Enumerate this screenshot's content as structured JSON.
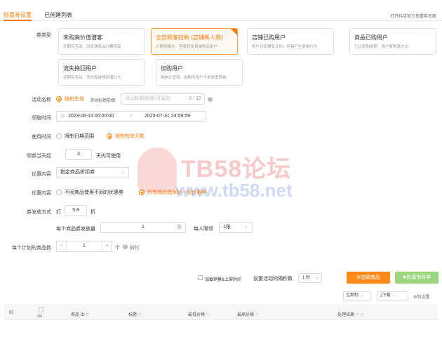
{
  "tabs": [
    {
      "label": "惊喜券设置"
    },
    {
      "label": "已创建列表"
    }
  ],
  "top_right_link": "打开抖店官方惊喜券页面",
  "coupon_type": {
    "label": "券类型",
    "cards": [
      {
        "title": "未购高价值潜客",
        "desc": "近期有互动、对店铺商品兴趣很高"
      },
      {
        "title": "全部新客拉新 (店铺新人券)",
        "desc": "人群规模大、容易转化首单购买用户"
      },
      {
        "title": "店铺已购用户",
        "desc": "用户对店铺有认知、容易产生复购行为"
      },
      {
        "title": "商品已购用户",
        "desc": "已过复购周期、用户复购潜力大"
      },
      {
        "title": "流失挽回用户",
        "desc": "近期有互动、流失者被挽回潜力大"
      },
      {
        "title": "加购用户",
        "desc": "购物车营销、加购的用户下单意愿很强"
      }
    ]
  },
  "activity_name": {
    "label": "活动名称",
    "option": "随机生成",
    "prefix_label": "活动标题前缀:",
    "placeholder": "活动标题前缀,可留空",
    "counter": "0 / 10"
  },
  "claim_time": {
    "label": "领取时间",
    "start": "2023-06-13 00:00:00",
    "sep": "-",
    "end": "2023-07-31 23:59:59"
  },
  "use_time": {
    "label": "使用时间",
    "options": [
      "限制日期范围",
      "限制有效天数"
    ]
  },
  "valid_days": {
    "label": "领券当天起",
    "value": "3",
    "suffix": "天内可使用"
  },
  "discount_content": {
    "label": "优惠内容",
    "value": "指定商品折扣券"
  },
  "discount_content2": {
    "label": "优惠内容",
    "options": [
      "不同商品使用不同的优惠券",
      "所有商品使用同一张优惠券"
    ]
  },
  "issue_method": {
    "label": "券发放方式",
    "prefix": "打",
    "value": "5.8",
    "suffix": "折"
  },
  "per_item": {
    "label": "每个商品券发放量",
    "value": "1",
    "unit": "张"
  },
  "per_person": {
    "label": "每人限领",
    "value": "1张"
  },
  "per_plan": {
    "label": "每个计划的商品数",
    "minus": "−",
    "value": "1",
    "plus": "+",
    "unit": "个",
    "help": "解析"
  },
  "toolbar": {
    "checkbox_label": "加载销量&上架时间",
    "interval_label": "设置活动间隔秒数",
    "interval_value": "1 秒",
    "load_btn": "⊕加载商品",
    "batch_btn": "批量惊喜券"
  },
  "table_tools": {
    "copy": "复制",
    "download": "下载",
    "settings": "列设置"
  },
  "table": {
    "columns": [
      "ID",
      "0/0",
      "商品 ID",
      "标题",
      "最低价格",
      "最高价格",
      "处理结果"
    ]
  },
  "watermark": {
    "line1": "TB58论坛",
    "line2": "www.tb58.net"
  },
  "colors": {
    "accent": "#ff7a00",
    "success": "#8fd46a"
  }
}
